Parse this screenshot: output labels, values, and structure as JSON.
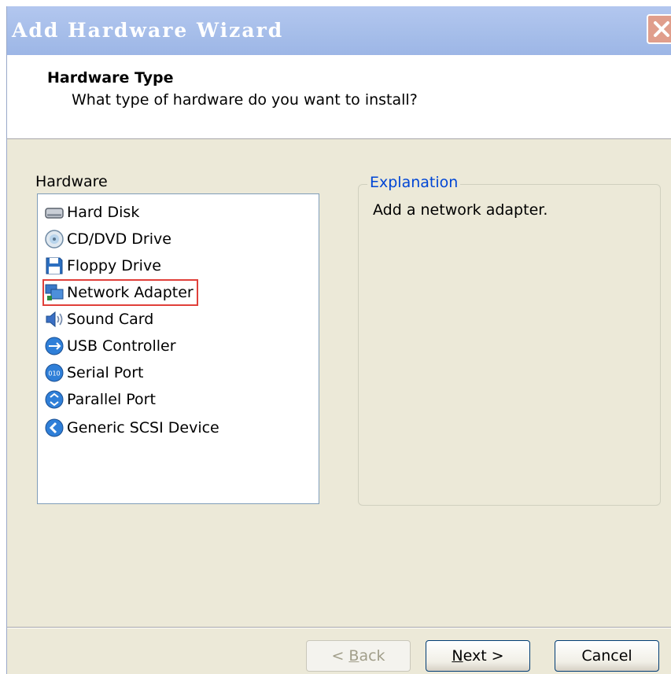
{
  "window": {
    "title": "Add Hardware Wizard"
  },
  "header": {
    "title": "Hardware Type",
    "subtitle": "What type of hardware do you want to install?"
  },
  "hardware": {
    "label": "Hardware",
    "items": [
      {
        "label": "Hard Disk",
        "icon": "hard-disk-icon"
      },
      {
        "label": "CD/DVD Drive",
        "icon": "cd-dvd-icon"
      },
      {
        "label": "Floppy Drive",
        "icon": "floppy-icon"
      },
      {
        "label": "Network Adapter",
        "icon": "network-adapter-icon",
        "selected": true
      },
      {
        "label": "Sound Card",
        "icon": "sound-card-icon"
      },
      {
        "label": "USB Controller",
        "icon": "usb-icon"
      },
      {
        "label": "Serial Port",
        "icon": "serial-port-icon"
      },
      {
        "label": "Parallel Port",
        "icon": "parallel-port-icon"
      },
      {
        "label": "Generic SCSI Device",
        "icon": "scsi-icon"
      }
    ]
  },
  "explanation": {
    "legend": "Explanation",
    "text": "Add a network adapter."
  },
  "buttons": {
    "back": {
      "prefix": "< ",
      "accel": "B",
      "rest": "ack",
      "enabled": false
    },
    "next": {
      "accel": "N",
      "rest": "ext >",
      "enabled": true
    },
    "cancel": {
      "label": "Cancel",
      "enabled": true
    }
  },
  "colors": {
    "selection_highlight": "#e0403a",
    "legend_text": "#0046d5",
    "dialog_bg": "#ece9d8"
  }
}
